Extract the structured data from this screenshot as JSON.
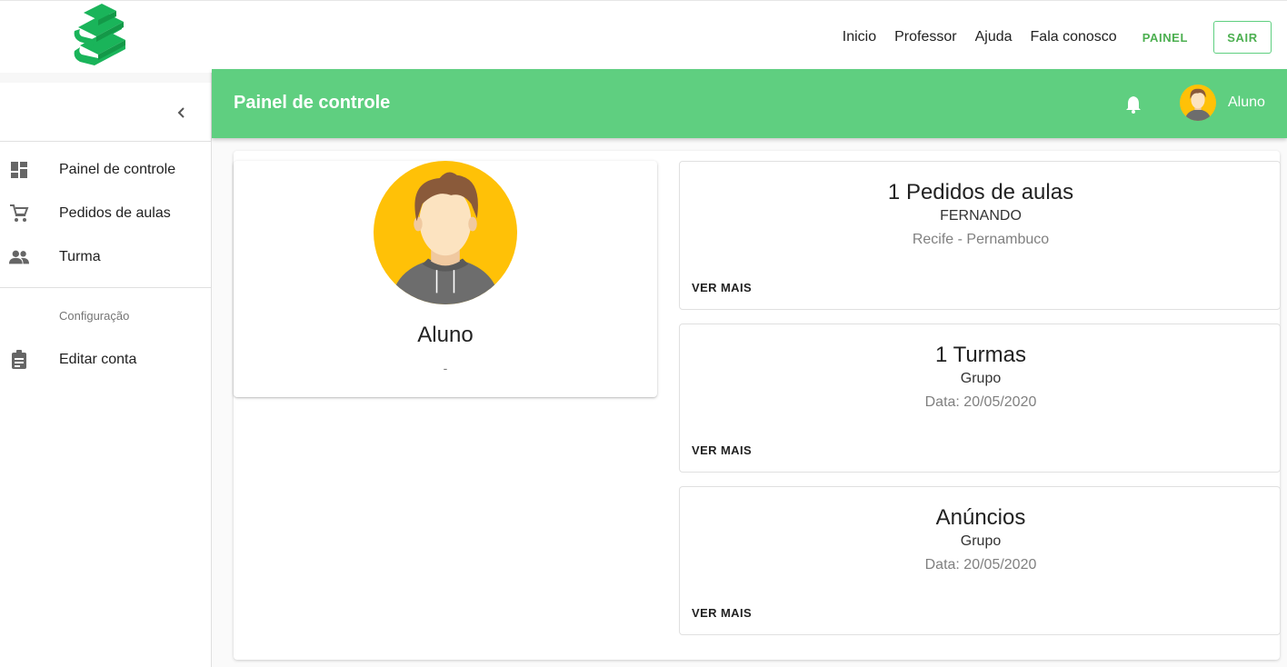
{
  "nav": {
    "links": [
      "Inicio",
      "Professor",
      "Ajuda",
      "Fala conosco"
    ],
    "painel": "PAINEL",
    "sair": "SAIR"
  },
  "sidebar": {
    "items": [
      {
        "label": "Painel de controle",
        "icon": "dashboard-icon"
      },
      {
        "label": "Pedidos de aulas",
        "icon": "cart-icon"
      },
      {
        "label": "Turma",
        "icon": "people-icon"
      }
    ],
    "section": "Configuração",
    "settings": [
      {
        "label": "Editar conta",
        "icon": "clipboard-icon"
      }
    ]
  },
  "appbar": {
    "title": "Painel de controle",
    "user": "Aluno"
  },
  "profile": {
    "name": "Aluno",
    "subtitle": "-"
  },
  "cards": [
    {
      "title": "1 Pedidos de aulas",
      "subtitle": "FERNANDO",
      "detail": "Recife - Pernambuco",
      "action": "VER MAIS"
    },
    {
      "title": "1 Turmas",
      "subtitle": "Grupo",
      "detail": "Data: 20/05/2020",
      "action": "VER MAIS"
    },
    {
      "title": "Anúncios",
      "subtitle": "Grupo",
      "detail": "Data: 20/05/2020",
      "action": "VER MAIS"
    }
  ],
  "colors": {
    "brand": "#5fcf80",
    "brand_dark": "#4caf50",
    "logo": "#1ab45a"
  }
}
